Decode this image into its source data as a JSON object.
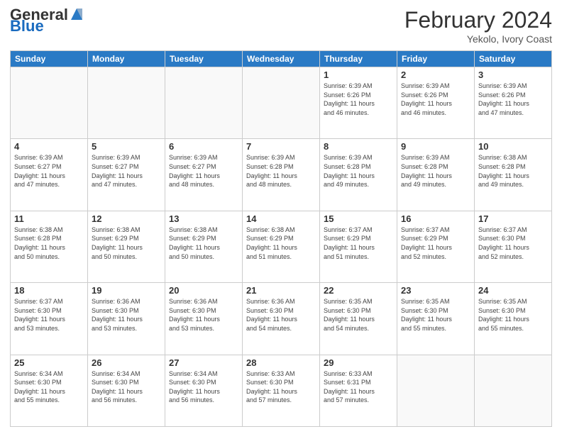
{
  "header": {
    "logo_general": "General",
    "logo_blue": "Blue",
    "month_year": "February 2024",
    "location": "Yekolo, Ivory Coast"
  },
  "weekdays": [
    "Sunday",
    "Monday",
    "Tuesday",
    "Wednesday",
    "Thursday",
    "Friday",
    "Saturday"
  ],
  "weeks": [
    [
      {
        "day": "",
        "info": ""
      },
      {
        "day": "",
        "info": ""
      },
      {
        "day": "",
        "info": ""
      },
      {
        "day": "",
        "info": ""
      },
      {
        "day": "1",
        "info": "Sunrise: 6:39 AM\nSunset: 6:26 PM\nDaylight: 11 hours\nand 46 minutes."
      },
      {
        "day": "2",
        "info": "Sunrise: 6:39 AM\nSunset: 6:26 PM\nDaylight: 11 hours\nand 46 minutes."
      },
      {
        "day": "3",
        "info": "Sunrise: 6:39 AM\nSunset: 6:26 PM\nDaylight: 11 hours\nand 47 minutes."
      }
    ],
    [
      {
        "day": "4",
        "info": "Sunrise: 6:39 AM\nSunset: 6:27 PM\nDaylight: 11 hours\nand 47 minutes."
      },
      {
        "day": "5",
        "info": "Sunrise: 6:39 AM\nSunset: 6:27 PM\nDaylight: 11 hours\nand 47 minutes."
      },
      {
        "day": "6",
        "info": "Sunrise: 6:39 AM\nSunset: 6:27 PM\nDaylight: 11 hours\nand 48 minutes."
      },
      {
        "day": "7",
        "info": "Sunrise: 6:39 AM\nSunset: 6:28 PM\nDaylight: 11 hours\nand 48 minutes."
      },
      {
        "day": "8",
        "info": "Sunrise: 6:39 AM\nSunset: 6:28 PM\nDaylight: 11 hours\nand 49 minutes."
      },
      {
        "day": "9",
        "info": "Sunrise: 6:39 AM\nSunset: 6:28 PM\nDaylight: 11 hours\nand 49 minutes."
      },
      {
        "day": "10",
        "info": "Sunrise: 6:38 AM\nSunset: 6:28 PM\nDaylight: 11 hours\nand 49 minutes."
      }
    ],
    [
      {
        "day": "11",
        "info": "Sunrise: 6:38 AM\nSunset: 6:28 PM\nDaylight: 11 hours\nand 50 minutes."
      },
      {
        "day": "12",
        "info": "Sunrise: 6:38 AM\nSunset: 6:29 PM\nDaylight: 11 hours\nand 50 minutes."
      },
      {
        "day": "13",
        "info": "Sunrise: 6:38 AM\nSunset: 6:29 PM\nDaylight: 11 hours\nand 50 minutes."
      },
      {
        "day": "14",
        "info": "Sunrise: 6:38 AM\nSunset: 6:29 PM\nDaylight: 11 hours\nand 51 minutes."
      },
      {
        "day": "15",
        "info": "Sunrise: 6:37 AM\nSunset: 6:29 PM\nDaylight: 11 hours\nand 51 minutes."
      },
      {
        "day": "16",
        "info": "Sunrise: 6:37 AM\nSunset: 6:29 PM\nDaylight: 11 hours\nand 52 minutes."
      },
      {
        "day": "17",
        "info": "Sunrise: 6:37 AM\nSunset: 6:30 PM\nDaylight: 11 hours\nand 52 minutes."
      }
    ],
    [
      {
        "day": "18",
        "info": "Sunrise: 6:37 AM\nSunset: 6:30 PM\nDaylight: 11 hours\nand 53 minutes."
      },
      {
        "day": "19",
        "info": "Sunrise: 6:36 AM\nSunset: 6:30 PM\nDaylight: 11 hours\nand 53 minutes."
      },
      {
        "day": "20",
        "info": "Sunrise: 6:36 AM\nSunset: 6:30 PM\nDaylight: 11 hours\nand 53 minutes."
      },
      {
        "day": "21",
        "info": "Sunrise: 6:36 AM\nSunset: 6:30 PM\nDaylight: 11 hours\nand 54 minutes."
      },
      {
        "day": "22",
        "info": "Sunrise: 6:35 AM\nSunset: 6:30 PM\nDaylight: 11 hours\nand 54 minutes."
      },
      {
        "day": "23",
        "info": "Sunrise: 6:35 AM\nSunset: 6:30 PM\nDaylight: 11 hours\nand 55 minutes."
      },
      {
        "day": "24",
        "info": "Sunrise: 6:35 AM\nSunset: 6:30 PM\nDaylight: 11 hours\nand 55 minutes."
      }
    ],
    [
      {
        "day": "25",
        "info": "Sunrise: 6:34 AM\nSunset: 6:30 PM\nDaylight: 11 hours\nand 55 minutes."
      },
      {
        "day": "26",
        "info": "Sunrise: 6:34 AM\nSunset: 6:30 PM\nDaylight: 11 hours\nand 56 minutes."
      },
      {
        "day": "27",
        "info": "Sunrise: 6:34 AM\nSunset: 6:30 PM\nDaylight: 11 hours\nand 56 minutes."
      },
      {
        "day": "28",
        "info": "Sunrise: 6:33 AM\nSunset: 6:30 PM\nDaylight: 11 hours\nand 57 minutes."
      },
      {
        "day": "29",
        "info": "Sunrise: 6:33 AM\nSunset: 6:31 PM\nDaylight: 11 hours\nand 57 minutes."
      },
      {
        "day": "",
        "info": ""
      },
      {
        "day": "",
        "info": ""
      }
    ]
  ]
}
